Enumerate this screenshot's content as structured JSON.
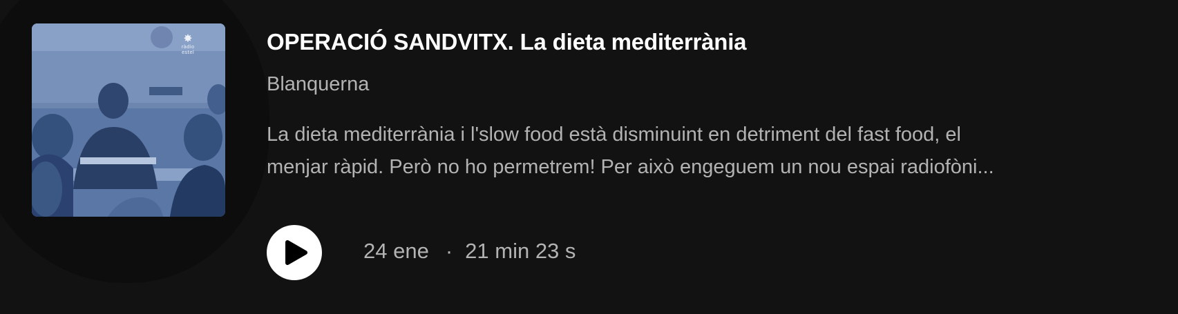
{
  "episode": {
    "title": "OPERACIÓ SANDVITX. La dieta mediterrània",
    "publisher": "Blanquerna",
    "description_lines": [
      "La dieta mediterrània i l'slow food està disminuint en detriment del fast food, el",
      "menjar ràpid. Però no ho permetrem! Per això engeguem un nou espai radiofòni..."
    ],
    "date": "24 ene",
    "separator": "·",
    "duration": "21 min 23 s"
  },
  "cover": {
    "logo_icon": "star-burst-icon",
    "logo_lines": [
      "ràdio",
      "estel"
    ],
    "tint_color": "#5a77a5"
  },
  "icons": {
    "play": "play-icon"
  },
  "colors": {
    "background": "#121212",
    "title": "#ffffff",
    "secondary_text": "#b3b3b3",
    "play_button": "#ffffff"
  }
}
